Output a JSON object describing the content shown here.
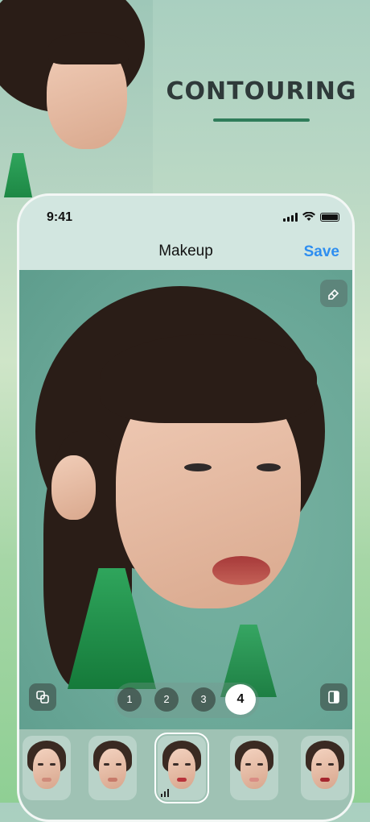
{
  "headline": "CONTOURING",
  "status_bar": {
    "time": "9:41"
  },
  "nav": {
    "title": "Makeup",
    "save_label": "Save"
  },
  "steps": [
    "1",
    "2",
    "3",
    "4"
  ],
  "active_step": "4",
  "colors": {
    "accent": "#2e8ef0",
    "headline_bar": "#2f7d5a",
    "earring": "#1f8f49"
  },
  "presets": [
    {
      "lip": "#cf8a7a"
    },
    {
      "lip": "#c77a6a"
    },
    {
      "lip": "#b8333b",
      "selected": true
    },
    {
      "lip": "#d98c84"
    },
    {
      "lip": "#a5262e"
    }
  ]
}
